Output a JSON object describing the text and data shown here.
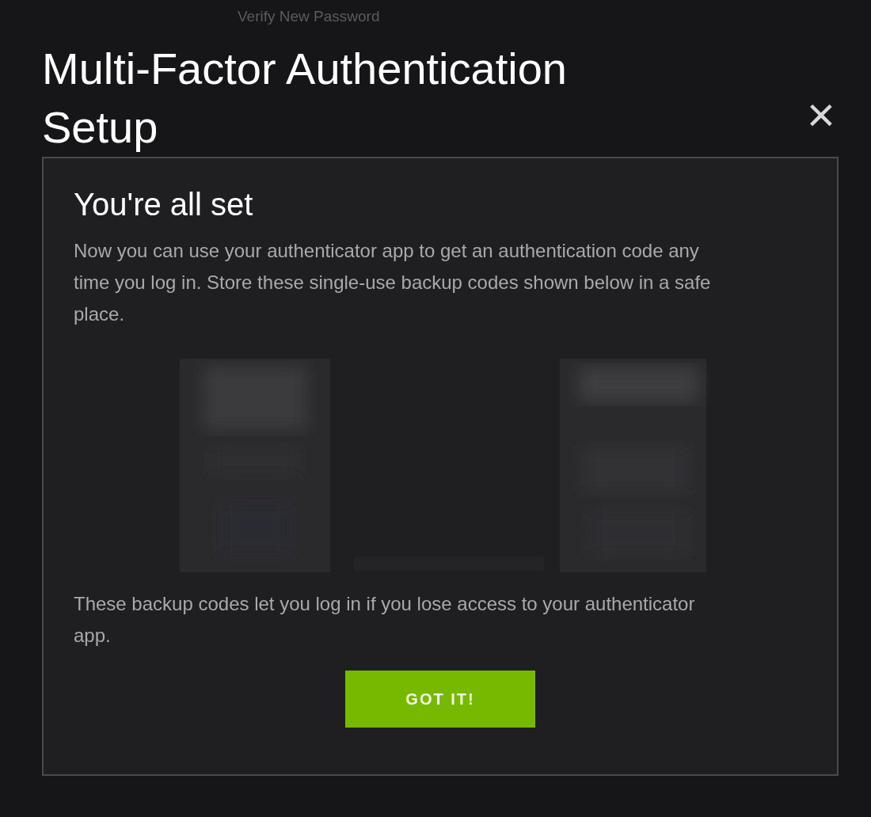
{
  "background": {
    "label": "Verify New Password"
  },
  "dialog": {
    "title": "Multi-Factor Authentication Setup",
    "close_icon": "×"
  },
  "card": {
    "heading": "You're all set",
    "intro": "Now you can use your authenticator app to get an authentication code any time you log in. Store these single-use backup codes shown below in a safe place.",
    "note": "These backup codes let you log in if you lose access to your authenticator app.",
    "button": "GOT IT!"
  }
}
